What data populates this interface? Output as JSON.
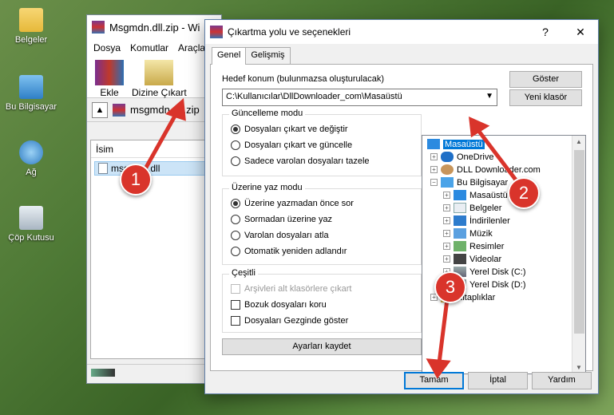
{
  "desktop": {
    "icons": [
      {
        "label": "Belgeler",
        "icon": "folder-icon"
      },
      {
        "label": "Bu Bilgisayar",
        "icon": "computer-icon"
      },
      {
        "label": "Ağ",
        "icon": "network-icon"
      },
      {
        "label": "Çöp Kutusu",
        "icon": "recycle-bin-icon"
      }
    ]
  },
  "winrar": {
    "title": "Msgmdn.dll.zip - Wi",
    "menu": [
      "Dosya",
      "Komutlar",
      "Araçla"
    ],
    "tools": {
      "add": "Ekle",
      "extract": "Dizine Çıkart"
    },
    "address": "msgmdn.dll.zip",
    "list_header": "İsim",
    "file": "msgmdn.dll"
  },
  "dialog": {
    "title": "Çıkartma yolu ve seçenekleri",
    "help": "?",
    "close": "✕",
    "tabs": [
      "Genel",
      "Gelişmiş"
    ],
    "dest_label": "Hedef konum (bulunmazsa oluşturulacak)",
    "dest_value": "C:\\Kullanıcılar\\DllDownloader_com\\Masaüstü",
    "show_button": "Göster",
    "new_folder_button": "Yeni klasör",
    "update_group": {
      "title": "Güncelleme modu",
      "options": [
        "Dosyaları çıkart ve değiştir",
        "Dosyaları çıkart ve güncelle",
        "Sadece varolan dosyaları tazele"
      ],
      "selected": 0
    },
    "overwrite_group": {
      "title": "Üzerine yaz modu",
      "options": [
        "Üzerine yazmadan önce sor",
        "Sormadan üzerine yaz",
        "Varolan dosyaları atla",
        "Otomatik yeniden adlandır"
      ],
      "selected": 0
    },
    "misc_group": {
      "title": "Çeşitli",
      "options": [
        "Arşivleri alt klasörlere çıkart",
        "Bozuk dosyaları koru",
        "Dosyaları Gezginde göster"
      ]
    },
    "save_settings": "Ayarları kaydet",
    "tree": [
      {
        "label": "Masaüstü",
        "icon": "desktop-icon"
      },
      {
        "label": "OneDrive",
        "icon": "onedrive-icon"
      },
      {
        "label": "DLL Downloader.com",
        "icon": "user-icon"
      },
      {
        "label": "Bu Bilgisayar",
        "icon": "computer-icon"
      },
      {
        "label": "Masaüstü",
        "icon": "desktop-icon"
      },
      {
        "label": "Belgeler",
        "icon": "document-icon"
      },
      {
        "label": "İndirilenler",
        "icon": "download-icon"
      },
      {
        "label": "Müzik",
        "icon": "music-icon"
      },
      {
        "label": "Resimler",
        "icon": "picture-icon"
      },
      {
        "label": "Videolar",
        "icon": "video-icon"
      },
      {
        "label": "Yerel Disk (C:)",
        "icon": "drive-icon"
      },
      {
        "label": "Yerel Disk (D:)",
        "icon": "drive-icon"
      },
      {
        "label": "Kitaplıklar",
        "icon": "library-icon"
      }
    ],
    "ok": "Tamam",
    "cancel": "İptal",
    "help_button": "Yardım"
  },
  "annotations": [
    "1",
    "2",
    "3"
  ],
  "colors": {
    "accent": "#0078d7",
    "annotation": "#d9342b"
  }
}
